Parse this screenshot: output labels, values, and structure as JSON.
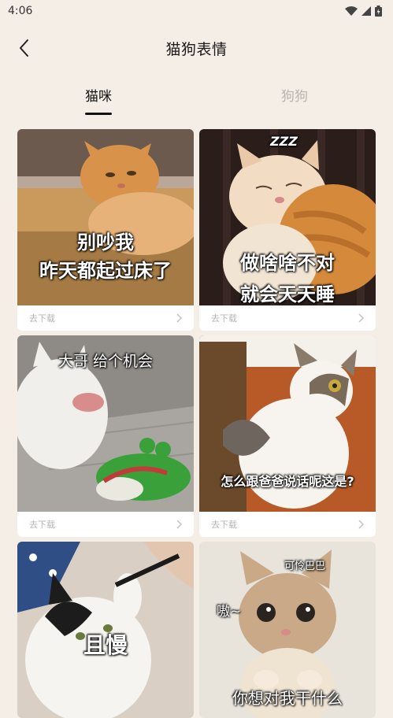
{
  "status": {
    "time": "4:06"
  },
  "header": {
    "title": "猫狗表情"
  },
  "tabs": [
    {
      "label": "猫咪",
      "active": true
    },
    {
      "label": "狗狗",
      "active": false
    }
  ],
  "cards": [
    {
      "lines": [
        "别吵我",
        "昨天都起过床了"
      ],
      "download_label": "去下载"
    },
    {
      "lines": [
        "ZZZ",
        "做啥啥不对",
        "就会天天睡"
      ],
      "download_label": "去下载"
    },
    {
      "lines": [
        "大哥 给个机会"
      ],
      "download_label": "去下载"
    },
    {
      "lines": [
        "怎么跟爸爸说话呢这是?"
      ],
      "download_label": "去下载"
    },
    {
      "lines": [
        "且慢"
      ],
      "download_label": ""
    },
    {
      "lines": [
        "可怜巴巴",
        "嗷~",
        "你想对我干什么"
      ],
      "download_label": ""
    }
  ],
  "colors": {
    "background": "#f5eee6",
    "card": "#ffffff",
    "tab_active": "#111111",
    "tab_inactive": "#b8b3ad",
    "footer_text": "#b5b5b5"
  }
}
